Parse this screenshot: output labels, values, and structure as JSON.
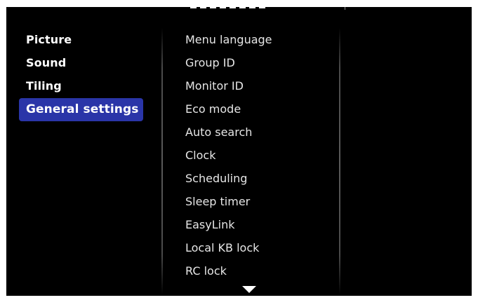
{
  "left_menu": {
    "items": [
      {
        "label": "Picture"
      },
      {
        "label": "Sound"
      },
      {
        "label": "Tiling"
      },
      {
        "label": "General settings"
      }
    ],
    "selected_index": 3,
    "selected_color": "#2a35a8"
  },
  "right_menu": {
    "items": [
      {
        "label": "Menu language"
      },
      {
        "label": "Group ID"
      },
      {
        "label": "Monitor ID"
      },
      {
        "label": "Eco mode"
      },
      {
        "label": "Auto search"
      },
      {
        "label": "Clock"
      },
      {
        "label": "Scheduling"
      },
      {
        "label": "Sleep timer"
      },
      {
        "label": "EasyLink"
      },
      {
        "label": "Local KB lock"
      },
      {
        "label": "RC lock"
      }
    ]
  },
  "icons": {
    "scroll_down": "triangle-down-icon"
  },
  "colors": {
    "background": "#000000",
    "text": "#ffffff",
    "accent": "#2a35a8"
  }
}
